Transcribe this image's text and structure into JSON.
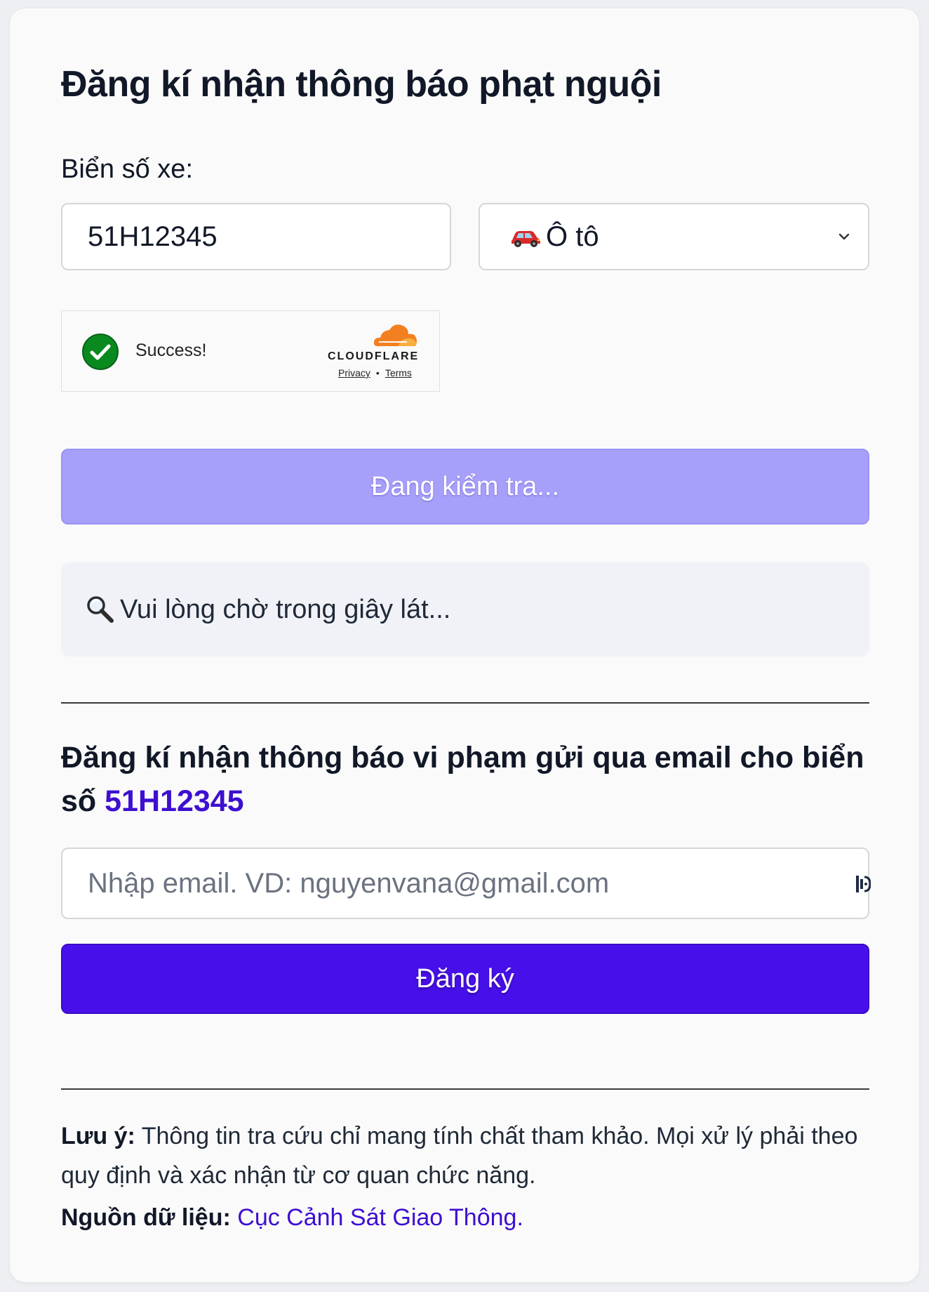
{
  "page": {
    "title": "Đăng kí nhận thông báo phạt nguội"
  },
  "form": {
    "plate_label": "Biển số xe:",
    "plate_value": "51H12345",
    "vehicle_type": {
      "selected": "Ô tô",
      "icon": "car-icon"
    },
    "turnstile": {
      "status": "Success!",
      "brand": "CLOUDFLARE",
      "privacy": "Privacy",
      "separator": "•",
      "terms": "Terms"
    },
    "check_button_label": "Đang kiểm tra...",
    "check_button_color": "#a7a0fb",
    "status_message": "Vui lòng chờ trong giây lát...",
    "status_icon": "magnifier-icon"
  },
  "subscribe": {
    "heading_text": "Đăng kí nhận thông báo vi phạm gửi qua email cho biển số",
    "heading_plate": "51H12345",
    "email_placeholder": "Nhập email. VD: nguyenvana@gmail.com",
    "email_value": "",
    "submit_label": "Đăng ký",
    "submit_color": "#4710eb"
  },
  "footer": {
    "note_label": "Lưu ý:",
    "note_text": "Thông tin tra cứu chỉ mang tính chất tham khảo. Mọi xử lý phải theo quy định và xác nhận từ cơ quan chức năng.",
    "source_label": "Nguồn dữ liệu:",
    "source_link": "Cục Cảnh Sát Giao Thông",
    "source_end": "."
  }
}
